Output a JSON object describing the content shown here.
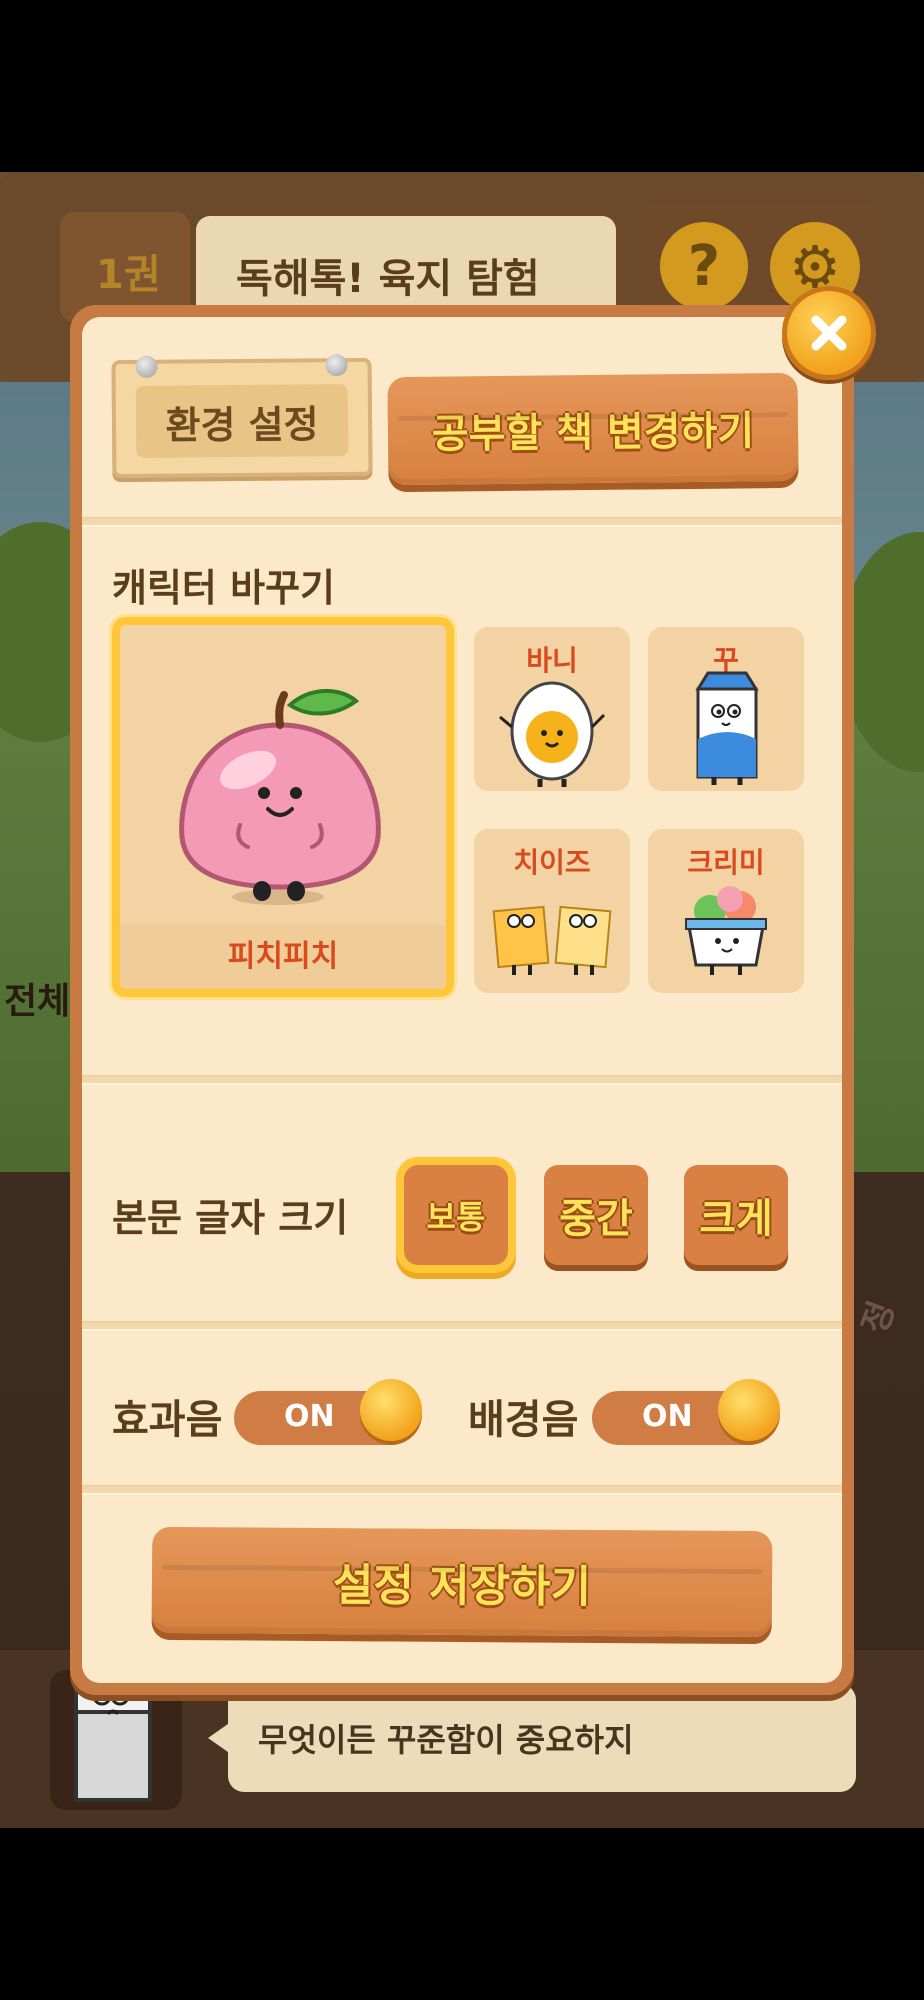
{
  "background": {
    "volume_label": "1권",
    "book_title": "독해톡! 육지 탐험",
    "help_icon": "question-mark-icon",
    "settings_icon": "gear-icon",
    "left_partial_text": "전체",
    "right_partial_text": "정"
  },
  "modal": {
    "settings_tab_label": "환경 설정",
    "change_book_label": "공부할 책 변경하기",
    "close_icon": "close-icon",
    "character_section_title": "캐릭터 바꾸기",
    "characters": [
      {
        "name": "피치피치",
        "selected": true,
        "color": "#f59ab6"
      },
      {
        "name": "바니",
        "selected": false,
        "color": "#ffffff"
      },
      {
        "name": "꾸",
        "selected": false,
        "color": "#3c8bde"
      },
      {
        "name": "치이즈",
        "selected": false,
        "color": "#ffc447"
      },
      {
        "name": "크리미",
        "selected": false,
        "color": "#6cc35a"
      }
    ],
    "font_size_title": "본문 글자 크기",
    "font_sizes": [
      {
        "label": "보통",
        "active": true
      },
      {
        "label": "중간",
        "active": false
      },
      {
        "label": "크게",
        "active": false
      }
    ],
    "sound_effects_label": "효과음",
    "sound_effects_state": "ON",
    "bgm_label": "배경음",
    "bgm_state": "ON",
    "save_label": "설정 저장하기"
  },
  "chat": {
    "message": "무엇이든 꾸준함이 중요하지"
  },
  "colors": {
    "accent_yellow": "#ffe35a",
    "wood": "#d7803f",
    "selected_border": "#ffc63a",
    "panel": "#fbe9c9"
  }
}
